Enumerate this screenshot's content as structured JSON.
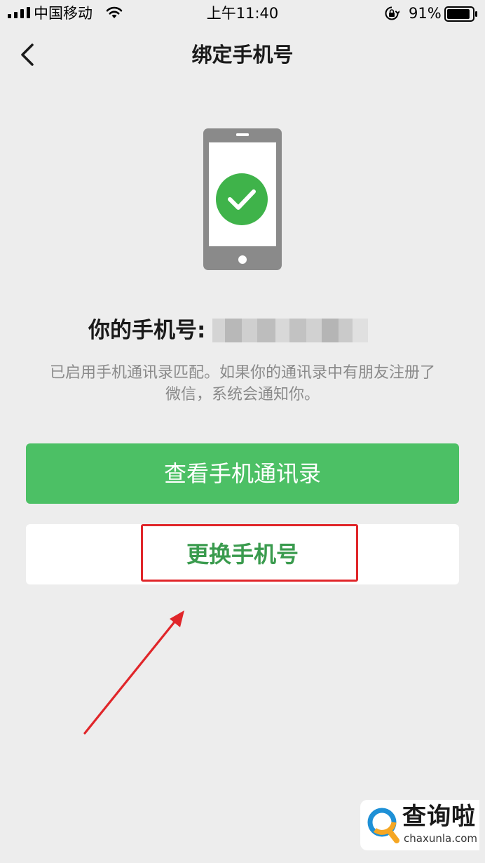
{
  "status_bar": {
    "carrier": "中国移动",
    "time": "上午11:40",
    "battery_percent": "91%",
    "battery_level": 0.91,
    "icons": [
      "signal-icon",
      "wifi-icon",
      "orientation-lock-icon",
      "battery-icon"
    ]
  },
  "nav": {
    "title": "绑定手机号",
    "back_icon": "chevron-left-icon"
  },
  "illustration": {
    "icon": "phone-check-icon",
    "colors": {
      "phone": "#8a8a8a",
      "screen": "#ffffff",
      "check_circle": "#3fb34a"
    }
  },
  "phone": {
    "label": "你的手机号:",
    "value_hidden": true
  },
  "description": {
    "line1": "已启用手机通讯录匹配。如果你的通讯录中有朋友注册了",
    "line2": "微信，系统会通知你。"
  },
  "buttons": {
    "view_contacts": "查看手机通讯录",
    "change_phone": "更换手机号"
  },
  "annotation": {
    "highlight_color": "#e0262a",
    "arrow_color": "#e0262a"
  },
  "watermark": {
    "name": "查询啦",
    "url": "chaxunla.com"
  },
  "colors": {
    "background": "#ededed",
    "primary_button": "#4cc065",
    "secondary_text": "#3a9b4e"
  }
}
